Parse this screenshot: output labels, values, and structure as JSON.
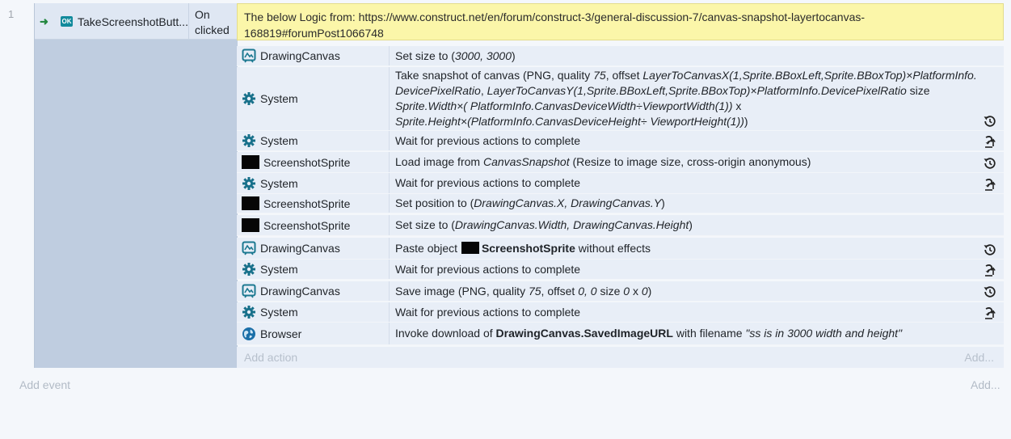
{
  "event": {
    "number": "1",
    "condition": {
      "object": "TakeScreenshotButt...",
      "badge": "OK",
      "text": "On clicked"
    },
    "comment": "The below Logic from: https://www.construct.net/en/forum/construct-3/general-discussion-7/canvas-snapshot-layertocanvas-168819#forumPost1066748",
    "actions": [
      {
        "object": "DrawingCanvas",
        "icon": "drawing-canvas-icon",
        "parts": [
          [
            "t",
            "Set size to ("
          ],
          [
            "i",
            "3000, 3000"
          ],
          [
            "t",
            ")"
          ]
        ],
        "status": ""
      },
      {
        "object": "System",
        "icon": "gear-icon",
        "parts": [
          [
            "t",
            "Take snapshot of canvas (PNG, quality "
          ],
          [
            "i",
            "75"
          ],
          [
            "t",
            ", offset "
          ],
          [
            "i",
            "LayerToCanvasX(1,Sprite.BBoxLeft,Sprite.BBoxTop)×PlatformInfo. DevicePixelRatio"
          ],
          [
            "t",
            ", "
          ],
          [
            "i",
            "LayerToCanvasY(1,Sprite.BBoxLeft,Sprite.BBoxTop)×PlatformInfo.DevicePixelRatio"
          ],
          [
            "t",
            " size "
          ],
          [
            "i",
            "Sprite.Width×( PlatformInfo.CanvasDeviceWidth÷ViewportWidth(1))"
          ],
          [
            "t",
            " x "
          ],
          [
            "i",
            "Sprite.Height×(PlatformInfo.CanvasDeviceHeight÷ ViewportHeight(1))"
          ],
          [
            "t",
            ")"
          ]
        ],
        "status": "async"
      },
      {
        "object": "System",
        "icon": "gear-icon",
        "parts": [
          [
            "t",
            "Wait for previous actions to complete"
          ]
        ],
        "status": "wait"
      },
      {
        "object": "ScreenshotSprite",
        "icon": "sprite-icon",
        "parts": [
          [
            "t",
            "Load image from "
          ],
          [
            "i",
            "CanvasSnapshot"
          ],
          [
            "t",
            " (Resize to image size, cross-origin anonymous)"
          ]
        ],
        "status": "async"
      },
      {
        "object": "System",
        "icon": "gear-icon",
        "parts": [
          [
            "t",
            "Wait for previous actions to complete"
          ]
        ],
        "status": "wait"
      },
      {
        "object": "ScreenshotSprite",
        "icon": "sprite-icon",
        "parts": [
          [
            "t",
            "Set position to ("
          ],
          [
            "i",
            "DrawingCanvas.X, DrawingCanvas.Y"
          ],
          [
            "t",
            ")"
          ]
        ],
        "status": ""
      },
      {
        "object": "ScreenshotSprite",
        "icon": "sprite-icon",
        "parts": [
          [
            "t",
            "Set size to ("
          ],
          [
            "i",
            "DrawingCanvas.Width, DrawingCanvas.Height"
          ],
          [
            "t",
            ")"
          ]
        ],
        "status": ""
      },
      {
        "object": "DrawingCanvas",
        "icon": "drawing-canvas-icon",
        "parts": [
          [
            "t",
            "Paste object "
          ],
          [
            "sprite",
            ""
          ],
          [
            "b",
            "ScreenshotSprite"
          ],
          [
            "t",
            " without effects"
          ]
        ],
        "status": "async"
      },
      {
        "object": "System",
        "icon": "gear-icon",
        "parts": [
          [
            "t",
            "Wait for previous actions to complete"
          ]
        ],
        "status": "wait"
      },
      {
        "object": "DrawingCanvas",
        "icon": "drawing-canvas-icon",
        "parts": [
          [
            "t",
            "Save image (PNG, quality "
          ],
          [
            "i",
            "75"
          ],
          [
            "t",
            ", offset "
          ],
          [
            "i",
            "0, 0"
          ],
          [
            "t",
            " size "
          ],
          [
            "i",
            "0"
          ],
          [
            "t",
            " x "
          ],
          [
            "i",
            "0"
          ],
          [
            "t",
            ")"
          ]
        ],
        "status": "async"
      },
      {
        "object": "System",
        "icon": "gear-icon",
        "parts": [
          [
            "t",
            "Wait for previous actions to complete"
          ]
        ],
        "status": "wait"
      },
      {
        "object": "Browser",
        "icon": "globe-icon",
        "parts": [
          [
            "t",
            "Invoke download of "
          ],
          [
            "b",
            "DrawingCanvas.SavedImageURL"
          ],
          [
            "t",
            " with filename "
          ],
          [
            "i",
            "\"ss is in 3000 width and height\""
          ]
        ],
        "status": ""
      }
    ],
    "add_action": "Add action",
    "add_action_right": "Add..."
  },
  "add_event": "Add event",
  "add_event_right": "Add...",
  "colors": {
    "accent": "#118a9c",
    "comment_bg": "#fbf6a9",
    "condition_panel": "#bfcde0",
    "action_row_bg": "#e8eef7",
    "trigger_green": "#24873f"
  }
}
